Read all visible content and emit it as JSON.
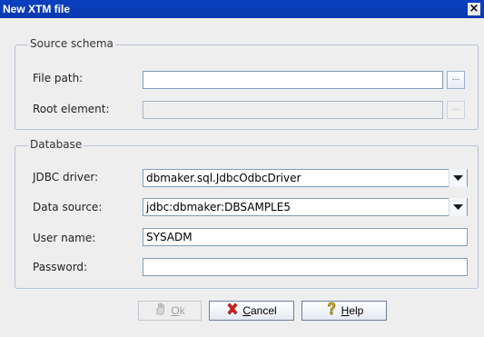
{
  "window": {
    "title": "New XTM file",
    "close_symbol": "×"
  },
  "source_schema": {
    "group_label": "Source schema",
    "file_path": {
      "label": "File path:",
      "value": ""
    },
    "root_element": {
      "label": "Root element:",
      "value": "",
      "enabled": false
    },
    "browse_label": "..."
  },
  "database": {
    "group_label": "Database",
    "jdbc_driver": {
      "label": "JDBC driver:",
      "value": "dbmaker.sql.JdbcOdbcDriver"
    },
    "data_source": {
      "label": "Data source:",
      "value": "jdbc:dbmaker:DBSAMPLE5"
    },
    "user_name": {
      "label": "User name:",
      "value": "SYSADM"
    },
    "password": {
      "label": "Password:",
      "value": ""
    }
  },
  "buttons": {
    "ok": {
      "mnemonic": "O",
      "rest": "k",
      "enabled": false,
      "icon": "hand-icon"
    },
    "cancel": {
      "mnemonic": "C",
      "rest": "ancel",
      "icon": "red-x-icon"
    },
    "help": {
      "mnemonic": "H",
      "rest": "elp",
      "icon": "question-icon"
    }
  },
  "colors": {
    "titlebar": "#0a3fbf",
    "group_border": "#b5c3d8",
    "cancel_icon": "#d42020",
    "help_icon": "#f2c200"
  }
}
